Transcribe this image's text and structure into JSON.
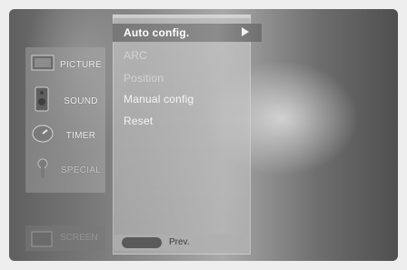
{
  "menu": {
    "items": [
      {
        "label": "PICTURE",
        "icon": "picture-icon"
      },
      {
        "label": "SOUND",
        "icon": "speaker-icon"
      },
      {
        "label": "TIMER",
        "icon": "clock-icon"
      },
      {
        "label": "SPECIAL",
        "icon": "key-icon"
      }
    ],
    "bottom_label": "SCREEN"
  },
  "submenu": {
    "items": [
      "Auto config.",
      "ARC",
      "Position",
      "Manual config",
      "Reset"
    ],
    "selected": "Auto config.",
    "selected_arrow": "▶"
  },
  "footer": {
    "prev_label": "Prev."
  }
}
